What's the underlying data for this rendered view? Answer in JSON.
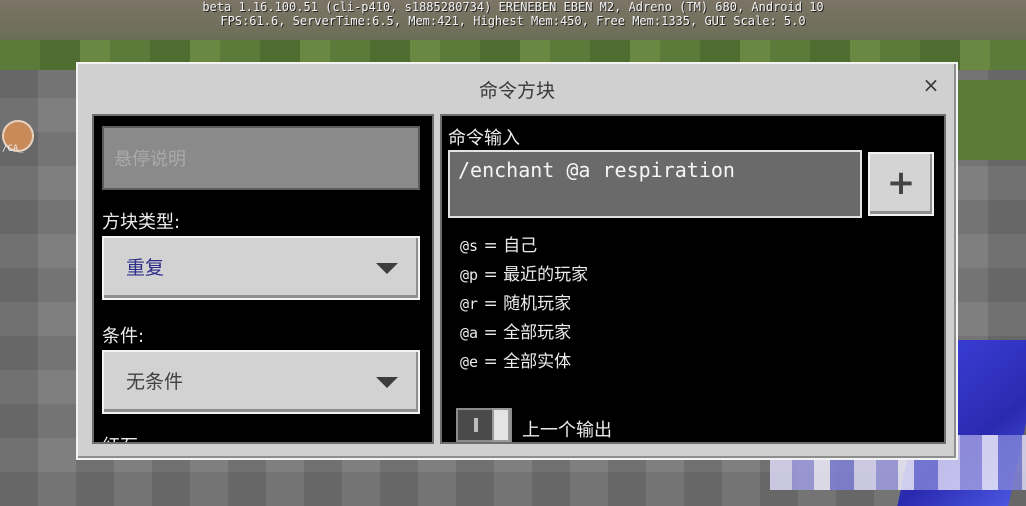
{
  "debug": {
    "line1": "beta 1.16.100.51 (cli-p410, s1885280734) ERENEBEN EBEN M2, Adreno (TM) 680, Android 10",
    "line2": "FPS:61.6, ServerTime:6.5, Mem:421, Highest Mem:450, Free Mem:1335, GUI Scale: 5.0"
  },
  "side": {
    "tag": "/CA_"
  },
  "dialog": {
    "title": "命令方块",
    "close_label": "×"
  },
  "left_panel": {
    "hover_note_placeholder": "悬停说明",
    "block_type_label": "方块类型:",
    "block_type_value": "重复",
    "condition_label": "条件:",
    "condition_value": "无条件",
    "redstone_label": "红石"
  },
  "right_panel": {
    "command_input_label": "命令输入",
    "command_value": "/enchant @a respiration",
    "add_label": "+",
    "selectors": [
      {
        "code": "@s",
        "desc": "自己"
      },
      {
        "code": "@p",
        "desc": "最近的玩家"
      },
      {
        "code": "@r",
        "desc": "随机玩家"
      },
      {
        "code": "@a",
        "desc": "全部玩家"
      },
      {
        "code": "@e",
        "desc": "全部实体"
      }
    ],
    "previous_output_label": "上一个输出"
  },
  "colors": {
    "dialog_bg": "#d0d0d0",
    "panel_bg": "#000000",
    "dropdown_bg": "#d2d2d2",
    "block_type_accent": "#2c2c8a"
  }
}
